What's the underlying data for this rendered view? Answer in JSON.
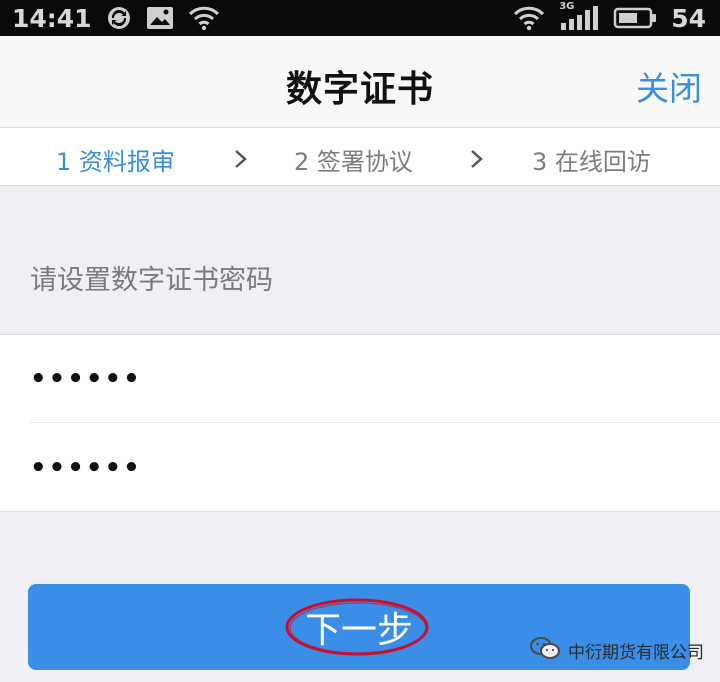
{
  "status_bar": {
    "time": "14:41",
    "battery": "54",
    "network": "3G",
    "icons": [
      "sync-icon",
      "image-icon",
      "wifi-icon",
      "wifi-icon",
      "signal-icon",
      "battery-icon"
    ]
  },
  "nav": {
    "title": "数字证书",
    "close_label": "关闭"
  },
  "steps": [
    {
      "label": "1 资料报审",
      "active": true
    },
    {
      "label": "2 签署协议",
      "active": false
    },
    {
      "label": "3 在线回访",
      "active": false
    }
  ],
  "form": {
    "hint": "请设置数字证书密码",
    "password_value": "••••••",
    "confirm_value": "••••••"
  },
  "next_button": {
    "label": "下一步"
  },
  "watermark": {
    "text": "中衍期货有限公司"
  },
  "colors": {
    "accent": "#3a8fd9",
    "button": "#3a8ee8",
    "annotation": "#c8102e"
  }
}
